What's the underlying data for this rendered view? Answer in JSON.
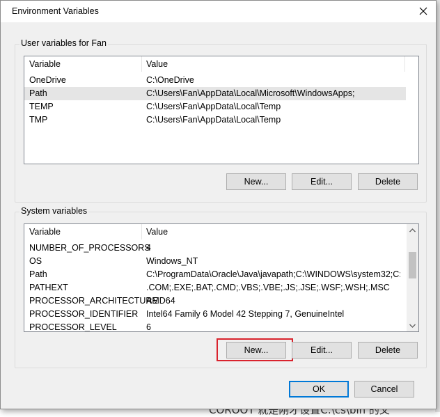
{
  "window": {
    "title": "Environment Variables"
  },
  "user_vars": {
    "group_label": "User variables for Fan",
    "columns": [
      "Variable",
      "Value"
    ],
    "rows": [
      {
        "name": "OneDrive",
        "value": "C:\\OneDrive"
      },
      {
        "name": "Path",
        "value": "C:\\Users\\Fan\\AppData\\Local\\Microsoft\\WindowsApps;"
      },
      {
        "name": "TEMP",
        "value": "C:\\Users\\Fan\\AppData\\Local\\Temp"
      },
      {
        "name": "TMP",
        "value": "C:\\Users\\Fan\\AppData\\Local\\Temp"
      }
    ],
    "selected_index": 1,
    "buttons": {
      "new": "New...",
      "edit": "Edit...",
      "delete": "Delete"
    }
  },
  "system_vars": {
    "group_label": "System variables",
    "columns": [
      "Variable",
      "Value"
    ],
    "rows": [
      {
        "name": "NUMBER_OF_PROCESSORS",
        "value": "4"
      },
      {
        "name": "OS",
        "value": "Windows_NT"
      },
      {
        "name": "Path",
        "value": "C:\\ProgramData\\Oracle\\Java\\javapath;C:\\WINDOWS\\system32;C:\\..."
      },
      {
        "name": "PATHEXT",
        "value": ".COM;.EXE;.BAT;.CMD;.VBS;.VBE;.JS;.JSE;.WSF;.WSH;.MSC"
      },
      {
        "name": "PROCESSOR_ARCHITECTURE",
        "value": "AMD64"
      },
      {
        "name": "PROCESSOR_IDENTIFIER",
        "value": "Intel64 Family 6 Model 42 Stepping 7, GenuineIntel"
      },
      {
        "name": "PROCESSOR_LEVEL",
        "value": "6"
      }
    ],
    "buttons": {
      "new": "New...",
      "edit": "Edit...",
      "delete": "Delete"
    }
  },
  "footer": {
    "ok": "OK",
    "cancel": "Cancel"
  },
  "background": {
    "bottom_text": "COROOT 就是刚才设置C:\\cs\\bin 的父"
  },
  "colors": {
    "highlight": "#d9232d",
    "accent": "#0078d7"
  }
}
